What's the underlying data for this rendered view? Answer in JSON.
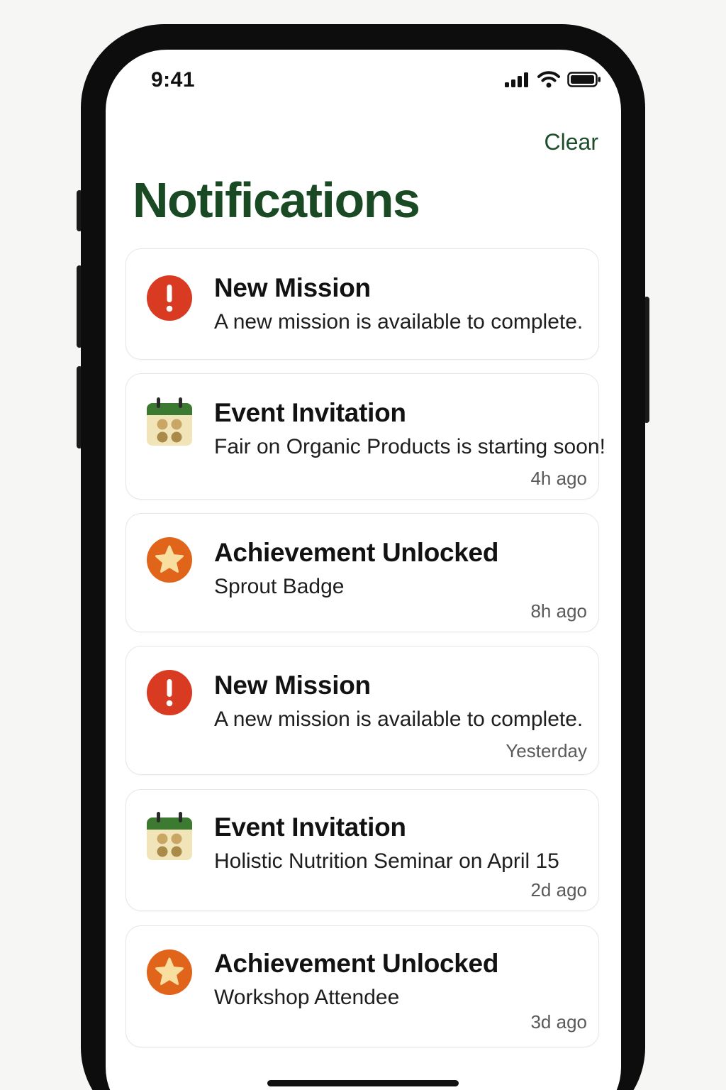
{
  "status_bar": {
    "time": "9:41",
    "signal_icon": "cellular-signal-icon",
    "wifi_icon": "wifi-icon",
    "battery_icon": "battery-icon"
  },
  "header": {
    "clear_label": "Clear",
    "title": "Notifications"
  },
  "colors": {
    "brand_green": "#1a4a24",
    "alert_red": "#d93a22",
    "achievement_orange": "#e0641a",
    "calendar_green": "#3c7a32"
  },
  "notifications": [
    {
      "icon": "alert-icon",
      "title": "New Mission",
      "body": "A new mission is available to complete.",
      "time": ""
    },
    {
      "icon": "calendar-icon",
      "title": "Event Invitation",
      "body": "Fair on Organic Products is starting soon!",
      "time": "4h ago"
    },
    {
      "icon": "star-badge-icon",
      "title": "Achievement Unlocked",
      "body": "Sprout Badge",
      "time": "8h ago"
    },
    {
      "icon": "alert-icon",
      "title": "New Mission",
      "body": "A new mission is available to complete.",
      "time": "Yesterday"
    },
    {
      "icon": "calendar-icon",
      "title": "Event Invitation",
      "body": "Holistic Nutrition Seminar on April 15",
      "time": "2d ago"
    },
    {
      "icon": "star-badge-icon",
      "title": "Achievement Unlocked",
      "body": "Workshop Attendee",
      "time": "3d ago"
    }
  ]
}
